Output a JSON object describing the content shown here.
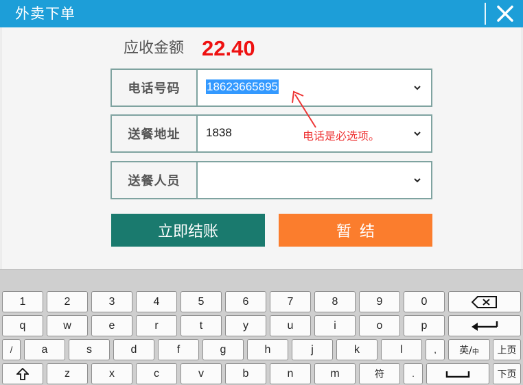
{
  "window": {
    "title": "外卖下单"
  },
  "summary": {
    "label": "应收金额",
    "amount": "22.40"
  },
  "fields": [
    {
      "label": "电话号码",
      "value": "18623665895"
    },
    {
      "label": "送餐地址",
      "value": "1838"
    },
    {
      "label": "送餐人员",
      "value": ""
    }
  ],
  "hint": "电话是必选项。",
  "buttons": {
    "checkout": "立即结账",
    "hold": "暂结"
  },
  "keyboard": {
    "row1": [
      "1",
      "2",
      "3",
      "4",
      "5",
      "6",
      "7",
      "8",
      "9",
      "0"
    ],
    "row2": [
      "q",
      "w",
      "e",
      "r",
      "t",
      "y",
      "u",
      "i",
      "o",
      "p"
    ],
    "row3": [
      "/",
      "a",
      "s",
      "d",
      "f",
      "g",
      "h",
      "j",
      "k",
      "l",
      ","
    ],
    "row4": [
      "z",
      "x",
      "c",
      "v",
      "b",
      "n",
      "m",
      "符",
      "."
    ],
    "lang_toggle": "英/",
    "lang_toggle_sub": "中",
    "page_up": "上页",
    "page_down": "下页"
  },
  "colors": {
    "titlebar": "#1d9ed8",
    "checkout": "#1a7a6e",
    "hold": "#fb7d2d",
    "amount": "#ee1111",
    "hint": "#e33333"
  },
  "icons": {
    "close": "close-icon",
    "backspace": "backspace-icon",
    "enter": "enter-icon",
    "shift": "shift-up-arrow-icon",
    "space": "space-bar-icon",
    "dropdown": "chevron-down-icon"
  }
}
